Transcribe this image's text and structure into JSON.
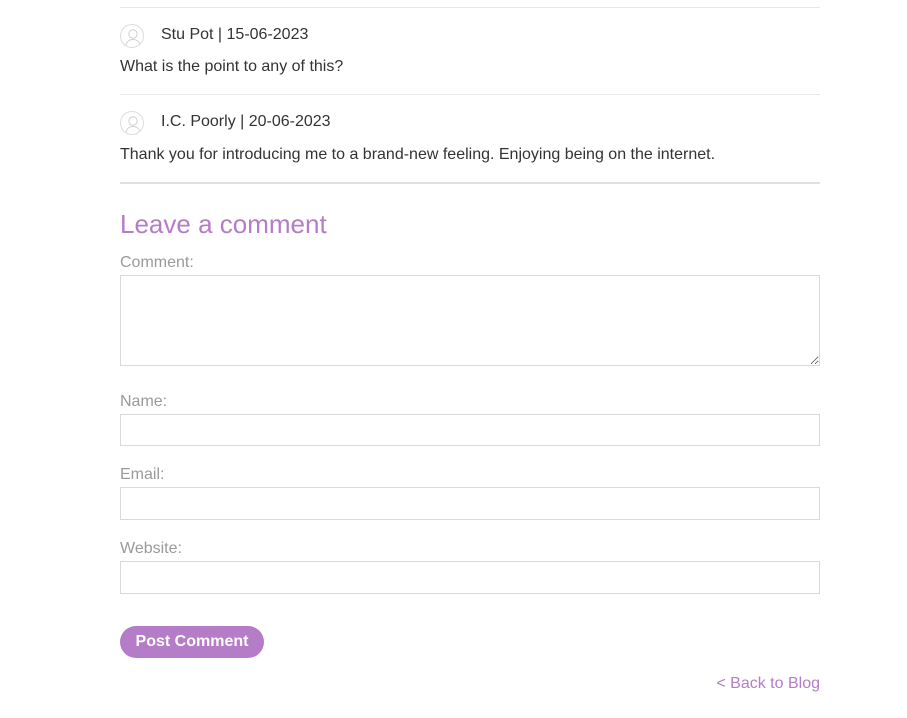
{
  "comments": [
    {
      "author_date": "Stu Pot | 15-06-2023",
      "text": "What is the point to any of this?"
    },
    {
      "author_date": "I.C. Poorly | 20-06-2023",
      "text": "Thank you for introducing me to a brand-new feeling. Enjoying being on the internet."
    }
  ],
  "form": {
    "title": "Leave a comment",
    "comment_label": "Comment:",
    "comment_value": "",
    "name_label": "Name:",
    "name_value": "",
    "email_label": "Email:",
    "email_value": "",
    "website_label": "Website:",
    "website_value": "",
    "submit_label": "Post Comment"
  },
  "back_link": "< Back to Blog",
  "icons": {
    "avatar": "user-avatar-icon"
  },
  "colors": {
    "accent": "#b57cc8",
    "text": "#333333",
    "label": "#9a9a9a",
    "border": "#d9d9d9"
  }
}
